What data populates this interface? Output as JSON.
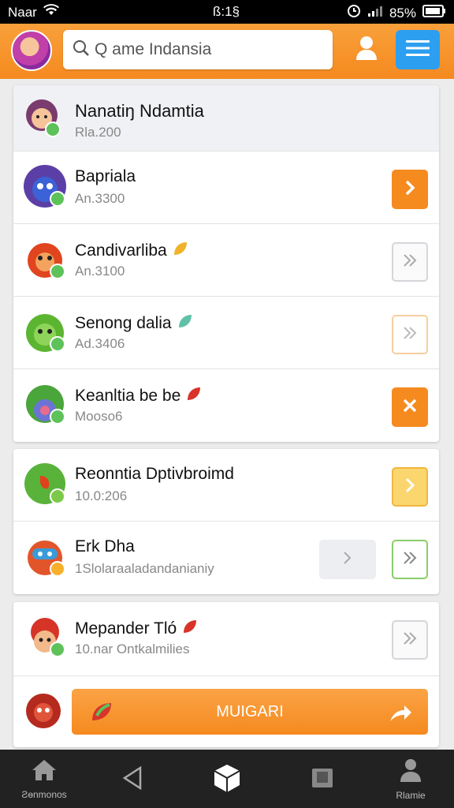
{
  "status": {
    "carrier": "Naar",
    "time": "ß:1§",
    "battery": "85%"
  },
  "search": {
    "placeholder": "Q ame Indansia"
  },
  "list_header": {
    "title": "Nanatiŋ Ndamtia",
    "subtitle": "Rla.200"
  },
  "group1": [
    {
      "title": "Bapriala",
      "subtitle": "An.3300",
      "action": "orange-chevron"
    },
    {
      "title": "Candivarliba",
      "subtitle": "An.3100",
      "action": "gray-chevron"
    },
    {
      "title": "Senong dalia",
      "subtitle": "Ad.3406",
      "action": "peach-chevron"
    },
    {
      "title": "Keanltia be be",
      "subtitle": "Mooso6",
      "action": "orange-close"
    }
  ],
  "group2": [
    {
      "title": "Reonntia Dptivbroimd",
      "subtitle": "10.0:206",
      "action": "yellow-chevron"
    },
    {
      "title": "Erk Dha",
      "subtitle": "1Slolaraaladandanianiy",
      "action": "green-chevron"
    }
  ],
  "group3": {
    "row": {
      "title": "Mepander Tló",
      "subtitle": "10.nar Ontkalmilies",
      "action": "gray-chevron"
    },
    "cta_label": "MUIGARI"
  },
  "nav": {
    "left_label": "Ƨɵnmonos",
    "right_label": "Rlamie"
  },
  "colors": {
    "accent": "#f58a1f",
    "menu_blue": "#2d9ff0"
  }
}
